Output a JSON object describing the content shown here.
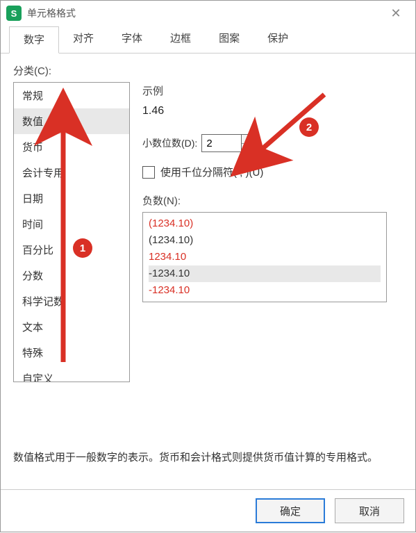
{
  "window": {
    "title": "单元格格式",
    "app_icon_letter": "S"
  },
  "tabs": {
    "items": [
      {
        "label": "数字"
      },
      {
        "label": "对齐"
      },
      {
        "label": "字体"
      },
      {
        "label": "边框"
      },
      {
        "label": "图案"
      },
      {
        "label": "保护"
      }
    ],
    "active_index": 0
  },
  "category": {
    "label": "分类(C):",
    "items": [
      "常规",
      "数值",
      "货币",
      "会计专用",
      "日期",
      "时间",
      "百分比",
      "分数",
      "科学记数",
      "文本",
      "特殊",
      "自定义"
    ],
    "selected_index": 1
  },
  "sample": {
    "label": "示例",
    "value": "1.46"
  },
  "decimal": {
    "label": "小数位数(D):",
    "value": "2"
  },
  "thousands": {
    "label": "使用千位分隔符( , )(U)",
    "checked": false
  },
  "negative": {
    "label": "负数(N):",
    "items": [
      {
        "text": "(1234.10)",
        "red": true
      },
      {
        "text": "(1234.10)",
        "red": false
      },
      {
        "text": "1234.10",
        "red": true
      },
      {
        "text": "-1234.10",
        "red": false
      },
      {
        "text": "-1234.10",
        "red": true
      }
    ],
    "selected_index": 3
  },
  "description": "数值格式用于一般数字的表示。货币和会计格式则提供货币值计算的专用格式。",
  "buttons": {
    "ok": "确定",
    "cancel": "取消"
  },
  "annotations": {
    "badge1": "1",
    "badge2": "2"
  }
}
